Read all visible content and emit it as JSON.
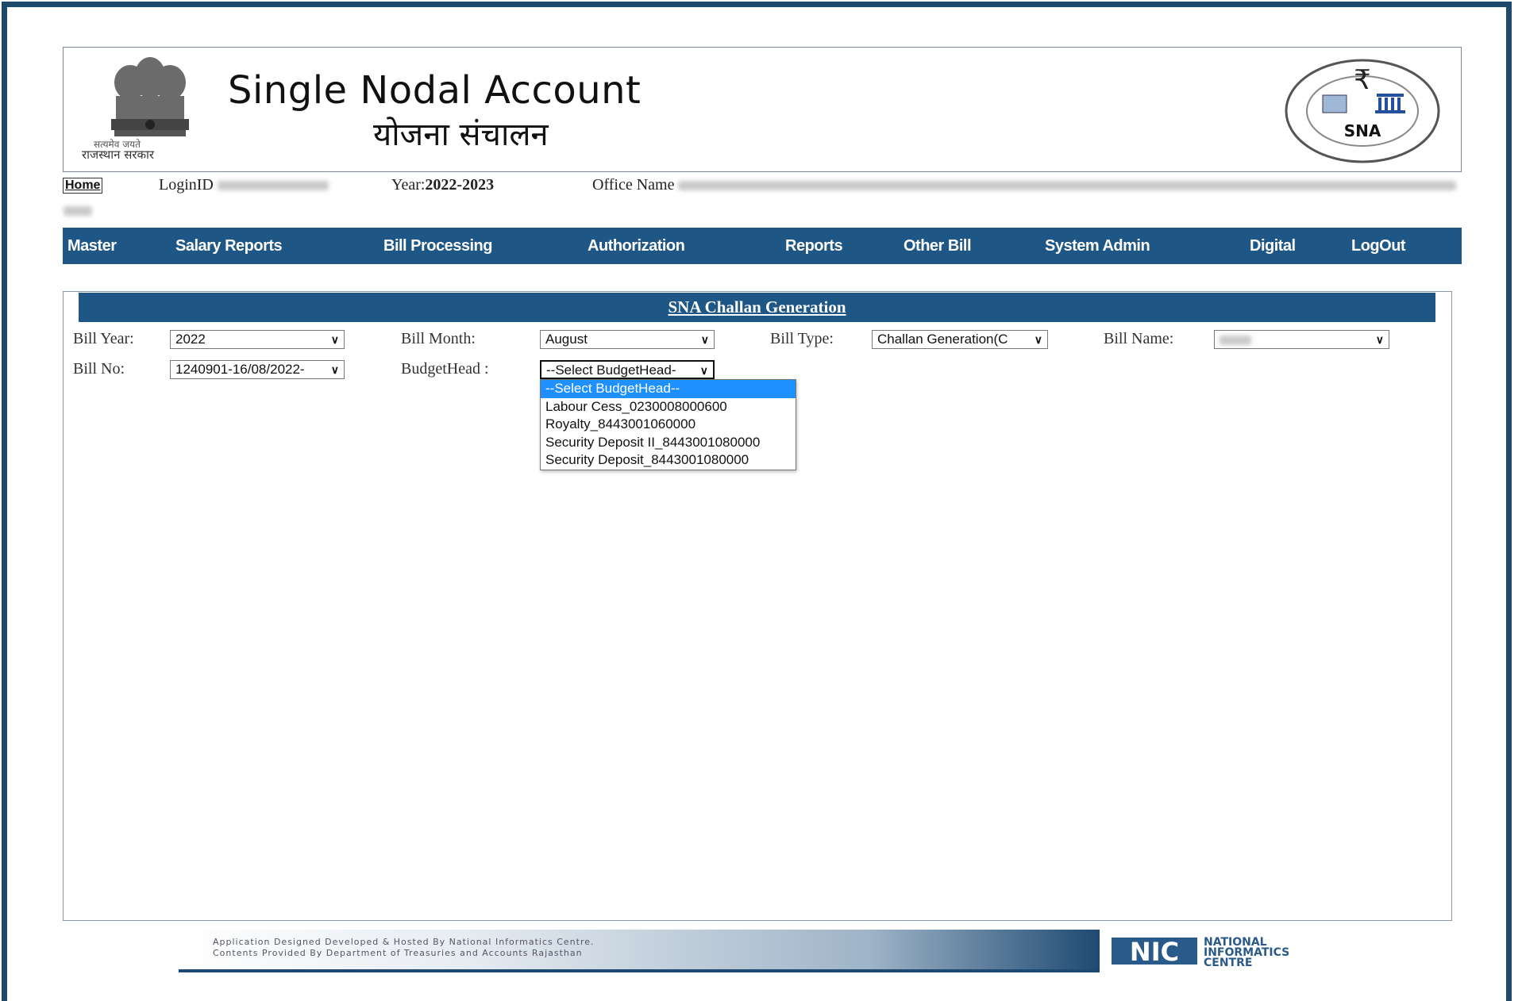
{
  "header": {
    "title": "Single Nodal Account",
    "subtitle": "योजना संचालन",
    "emblem_motto": "सत्यमेव जयते",
    "emblem_label": "राजस्थान सरकार",
    "sna_logo_text": "SNA",
    "sna_logo_ring": "Single Nodal Account"
  },
  "info": {
    "home": "Home",
    "login_label": "LoginID",
    "year_label": "Year:",
    "year_value": "2022-2023",
    "office_label": "Office Name"
  },
  "nav": {
    "items": [
      "Master",
      "Salary Reports",
      "Bill Processing",
      "Authorization",
      "Reports",
      "Other Bill",
      "System Admin",
      "Digital",
      "LogOut"
    ]
  },
  "form": {
    "title": "SNA Challan Generation",
    "bill_year_label": "Bill Year:",
    "bill_year_value": "2022",
    "bill_month_label": "Bill Month:",
    "bill_month_value": "August",
    "bill_type_label": "Bill Type:",
    "bill_type_value": "Challan Generation(C",
    "bill_name_label": "Bill Name:",
    "bill_no_label": "Bill No:",
    "bill_no_value": "1240901-16/08/2022-",
    "budget_head_label": "BudgetHead :",
    "budget_head_value": "--Select BudgetHead-",
    "budget_head_options": [
      "--Select BudgetHead--",
      "Labour Cess_0230008000600",
      "Royalty_8443001060000",
      "Security Deposit II_8443001080000",
      "Security Deposit_8443001080000"
    ]
  },
  "footer": {
    "line1": "Application Designed Developed & Hosted By National Informatics Centre.",
    "line2": "Contents Provided By Department of Treasuries and Accounts Rajasthan",
    "nic_line1": "NATIONAL",
    "nic_line2": "INFORMATICS",
    "nic_line3": "CENTRE",
    "nic_mark": "NIC"
  },
  "colors": {
    "nav_bg": "#1e5685",
    "frame": "#1e4a6e",
    "selected_option": "#1e90ff"
  }
}
